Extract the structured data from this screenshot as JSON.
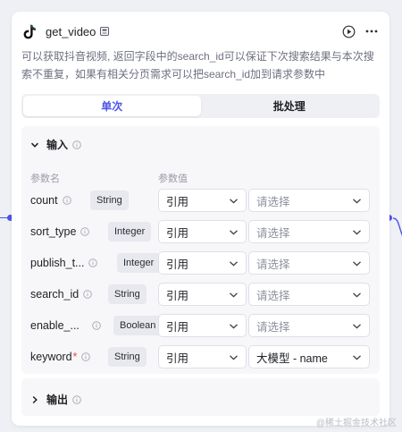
{
  "node": {
    "title": "get_video",
    "description": "可以获取抖音视频, 返回字段中的search_id可以保证下次搜索结果与本次搜索不重复，如果有相关分页需求可以把search_id加到请求参数中",
    "icon": "tiktok-logo",
    "accent_color": "#4d53e8"
  },
  "tabs": [
    {
      "label": "单次",
      "active": true
    },
    {
      "label": "批处理",
      "active": false
    }
  ],
  "input_section": {
    "title": "输入",
    "col_name": "参数名",
    "col_value": "参数值",
    "params": [
      {
        "name": "count",
        "required": false,
        "type": "String",
        "ref": "引用",
        "value": "请选择",
        "is_placeholder": true
      },
      {
        "name": "sort_type",
        "required": false,
        "type": "Integer",
        "ref": "引用",
        "value": "请选择",
        "is_placeholder": true
      },
      {
        "name": "publish_t...",
        "required": false,
        "type": "Integer",
        "ref": "引用",
        "value": "请选择",
        "is_placeholder": true
      },
      {
        "name": "search_id",
        "required": false,
        "type": "String",
        "ref": "引用",
        "value": "请选择",
        "is_placeholder": true
      },
      {
        "name": "enable_...",
        "required": false,
        "type": "Boolean",
        "ref": "引用",
        "value": "请选择",
        "is_placeholder": true
      },
      {
        "name": "keyword",
        "required": true,
        "type": "String",
        "ref": "引用",
        "value": "大模型 - name",
        "is_placeholder": false
      }
    ]
  },
  "output_section": {
    "title": "输出"
  },
  "watermark": "@稀土掘金技术社区"
}
